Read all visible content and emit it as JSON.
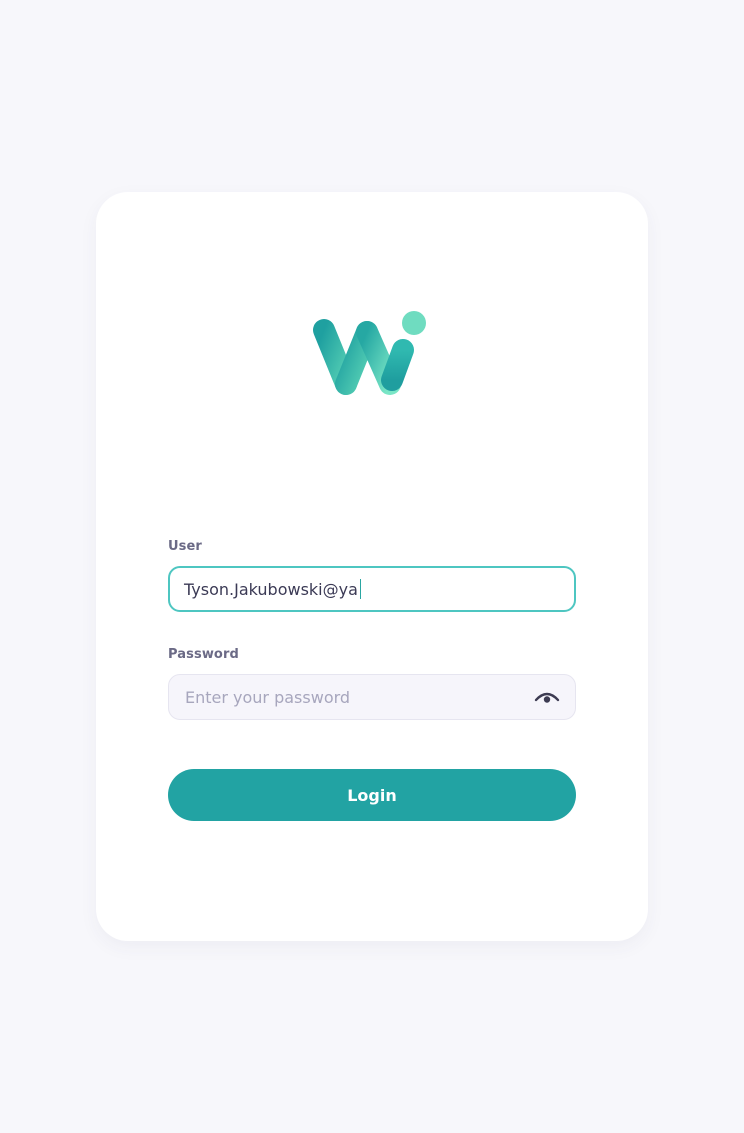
{
  "logo": {
    "icon": "w-brand-logo",
    "colors": {
      "teal_dark": "#1ea3a3",
      "teal_light": "#72e0c1"
    }
  },
  "form": {
    "user": {
      "label": "User",
      "value": "Tyson.Jakubowski@ya"
    },
    "password": {
      "label": "Password",
      "placeholder": "Enter your password",
      "toggle_icon": "eye-icon"
    },
    "login_label": "Login"
  },
  "colors": {
    "background": "#f7f7fb",
    "card": "#ffffff",
    "accent": "#22a3a3",
    "focus_border": "#4ec6c1",
    "label": "#6b6a86"
  }
}
